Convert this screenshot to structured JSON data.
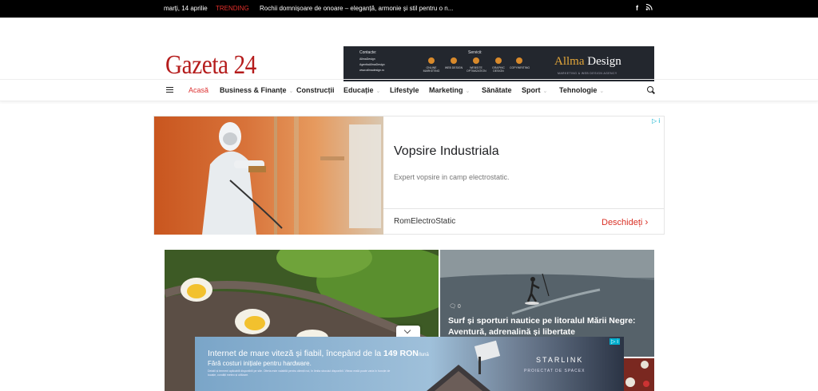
{
  "topbar": {
    "date": "marți, 14 aprilie",
    "trending_label": "TRENDING",
    "ticker": "Rochii domnișoare de onoare – eleganță, armonie și stil pentru o n..."
  },
  "header": {
    "logo": "Gazeta 24"
  },
  "banner_ad": {
    "contact_label": "Contacte:",
    "contact_lines": [
      "AllmaDesign",
      "AgentiaAllmaDesign",
      "www.allmadesign.ro"
    ],
    "services_label": "Servicii:",
    "services": [
      "ONLINE MARKETING",
      "WEB DESIGN",
      "WEBSITE OPTIMIZATION",
      "GRAPHIC DESIGN",
      "COPYWRITING"
    ],
    "brand_a": "Allma",
    "brand_b": "Design",
    "tagline": "MARKETING & WEB DESIGN AGENCY"
  },
  "nav": {
    "items": [
      {
        "label": "Acasă"
      },
      {
        "label": "Business & Finanțe",
        "dropdown": "⌄"
      },
      {
        "label": "Construcții"
      },
      {
        "label": "Educație",
        "dropdown": "⌄"
      },
      {
        "label": "Lifestyle"
      },
      {
        "label": "Marketing",
        "dropdown": "⌄"
      },
      {
        "label": "Sănătate"
      },
      {
        "label": "Sport",
        "dropdown": "⌄"
      },
      {
        "label": "Tehnologie",
        "dropdown": "⌄"
      }
    ]
  },
  "ad_vopsire": {
    "title": "Vopsire Industriala",
    "description": "Expert vopsire in camp electrostatic.",
    "advertiser": "RomElectroStatic",
    "cta": "Deschideți",
    "adchoices": "▷ i"
  },
  "featured": {
    "right": {
      "comment_count": "0",
      "headline": "Surf și sporturi nautice pe litoralul Mării Negre: Aventură, adrenalină și libertate"
    }
  },
  "ad_starlink": {
    "headline_a": "Internet de mare viteză și fiabil, începând de la ",
    "headline_price": "149 RON",
    "headline_unit": "/lună",
    "subline": "Fără costuri inițiale pentru hardware.",
    "fine_print": "Detalii și termeni aplicabili disponibili pe site. Oferta este valabilă pentru clienții noi, în limita stocului disponibil. Viteza reală poate varia în funcție de locație, condiții meteo și utilizare.",
    "brand": "STARLINK",
    "brand_sub": "PROIECTAT DE SPACEX",
    "adchoices": "▷ i"
  }
}
